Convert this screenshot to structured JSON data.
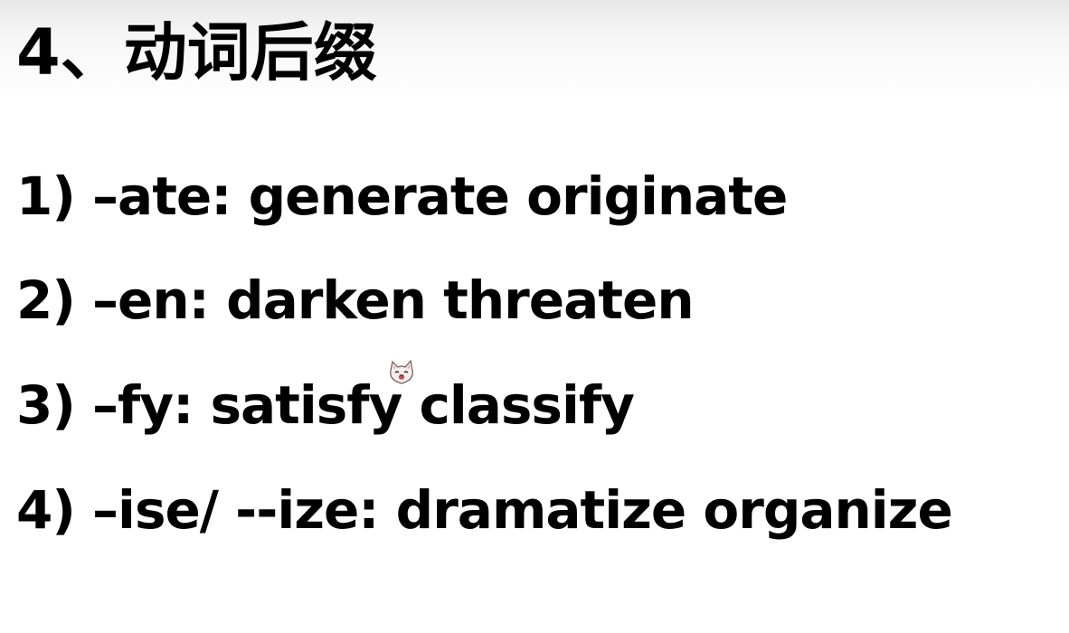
{
  "slide": {
    "title": "4、动词后缀",
    "items": [
      {
        "text": "1) –ate: generate originate"
      },
      {
        "text": "2) –en: darken threaten"
      },
      {
        "text": "3) –fy: satisfy classify"
      },
      {
        "text": "4) –ise/ --ize: dramatize organize"
      }
    ]
  },
  "colors": {
    "text": "#000000",
    "background": "#ffffff",
    "header_shade": "#e8e8e8"
  },
  "icons": {
    "sticker": "cat-face-icon"
  }
}
